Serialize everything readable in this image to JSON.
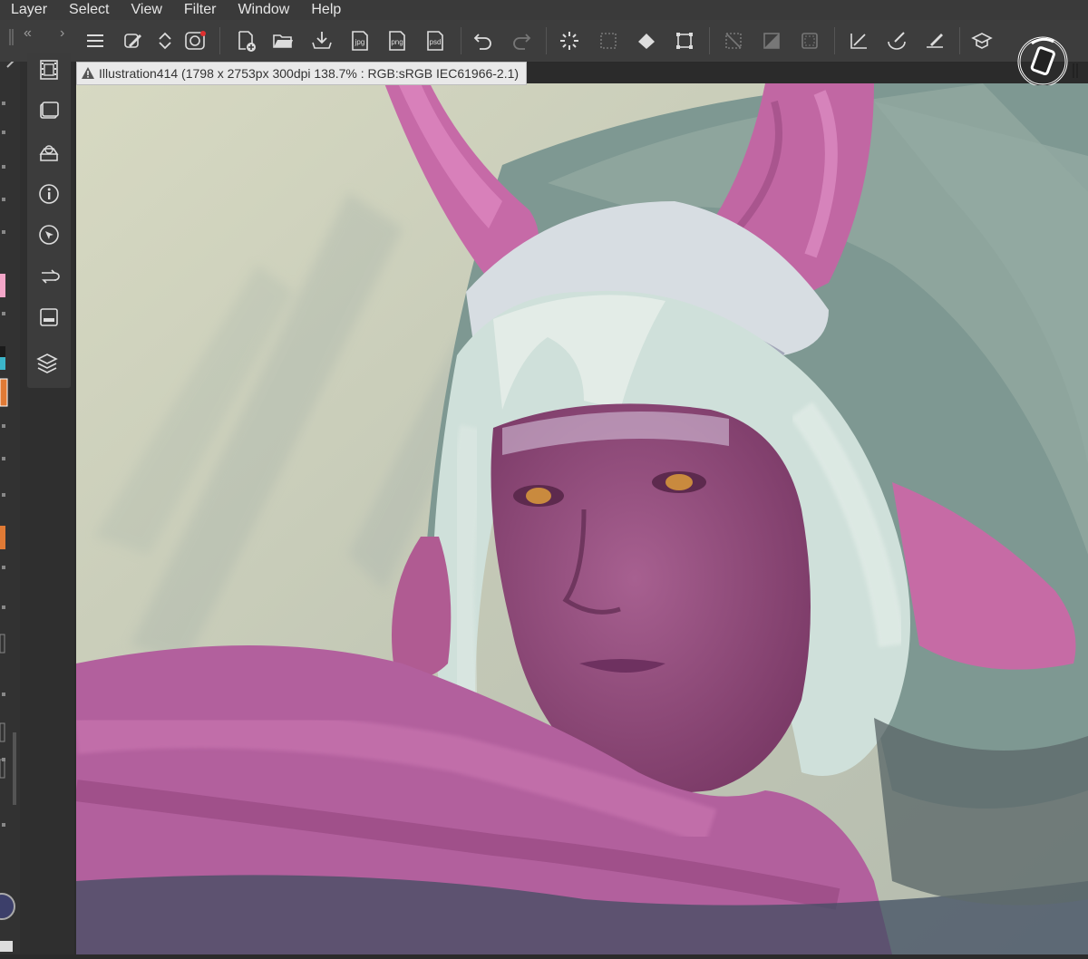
{
  "menu": [
    "Layer",
    "Select",
    "View",
    "Filter",
    "Window",
    "Help"
  ],
  "document": {
    "title": "Illustration414 (1798 x 2753px 300dpi 138.7% : RGB:sRGB IEC61966-2.1)"
  },
  "toolbar_icons": [
    "menu-icon",
    "pen-settings-icon",
    "arrows-updown-icon",
    "cloud-sync-icon",
    "new-canvas-icon",
    "open-folder-icon",
    "save-icon",
    "export-jpg-icon",
    "export-png-icon",
    "export-psd-icon",
    "undo-icon",
    "redo-icon",
    "clear-icon",
    "selection-icon",
    "fill-icon",
    "transform-icon",
    "deselect-icon",
    "invert-selection-icon",
    "selection-border-icon",
    "ruler-icon",
    "brush-icon",
    "pen-icon",
    "learn-icon"
  ],
  "export_labels": {
    "jpg": "jpg",
    "png": "png",
    "psd": "psd"
  },
  "colors": {
    "menubar": "#3a3a3a",
    "toolbar": "#3d3d3d",
    "panel": "#2f2f2f",
    "accent_orange": "#e07a35"
  }
}
